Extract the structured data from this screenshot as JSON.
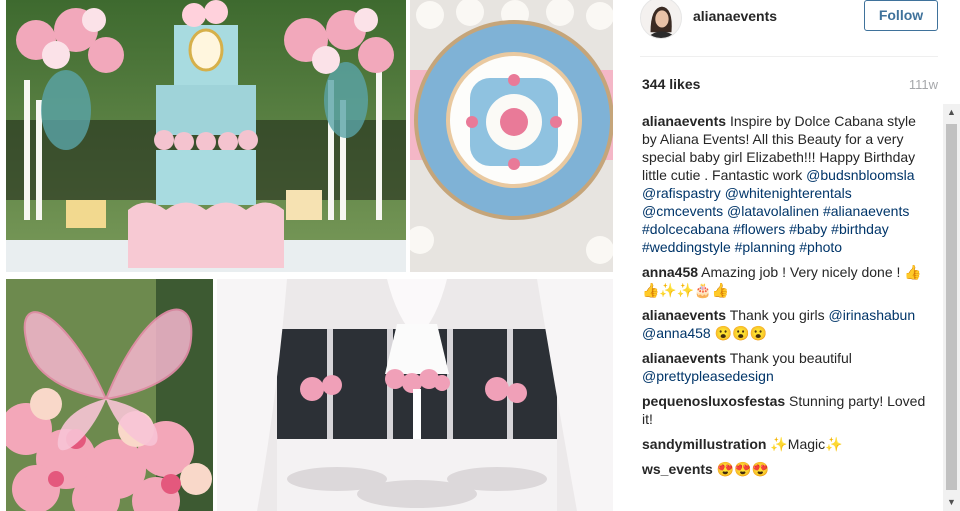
{
  "post": {
    "username": "alianaevents",
    "follow_label": "Follow",
    "likes": "344 likes",
    "time_ago": "111w"
  },
  "caption": {
    "user": "alianaevents",
    "text": "Inspire by Dolce Cabana style by Aliana Events! All this Beauty for a very special baby girl Elizabeth!!! Happy Birthday little cutie . Fantastic work",
    "tags": [
      "@budsnbloomsla",
      "@rafispastry",
      "@whitenighterentals",
      "@cmcevents",
      "@latavolalinen",
      "#alianaevents",
      "#dolcecabana",
      "#flowers",
      "#baby",
      "#birthday",
      "#weddingstyle",
      "#planning",
      "#photo"
    ]
  },
  "comments": [
    {
      "user": "anna458",
      "text": "Amazing job ! Very nicely done !",
      "tags": [],
      "suffix": "👍👍✨✨🎂👍"
    },
    {
      "user": "alianaevents",
      "text": "Thank you girls",
      "tags": [
        "@irinashabun",
        "@anna458"
      ],
      "suffix": "😮😮😮"
    },
    {
      "user": "alianaevents",
      "text": "Thank you beautiful",
      "tags": [
        "@prettypleasedesign"
      ],
      "suffix": ""
    },
    {
      "user": "pequenosluxosfestas",
      "text": "Stunning party! Loved it!",
      "tags": [],
      "suffix": ""
    },
    {
      "user": "sandymillustration",
      "text": "✨Magic✨",
      "tags": [],
      "suffix": ""
    },
    {
      "user": "ws_events",
      "text": "😍😍😍",
      "tags": [],
      "suffix": ""
    }
  ],
  "icons": {
    "scroll_up": "▲",
    "scroll_down": "▼"
  },
  "colors": {
    "link": "#003569",
    "follow_border": "#3f729b",
    "timestamp": "#a5a7aa"
  }
}
